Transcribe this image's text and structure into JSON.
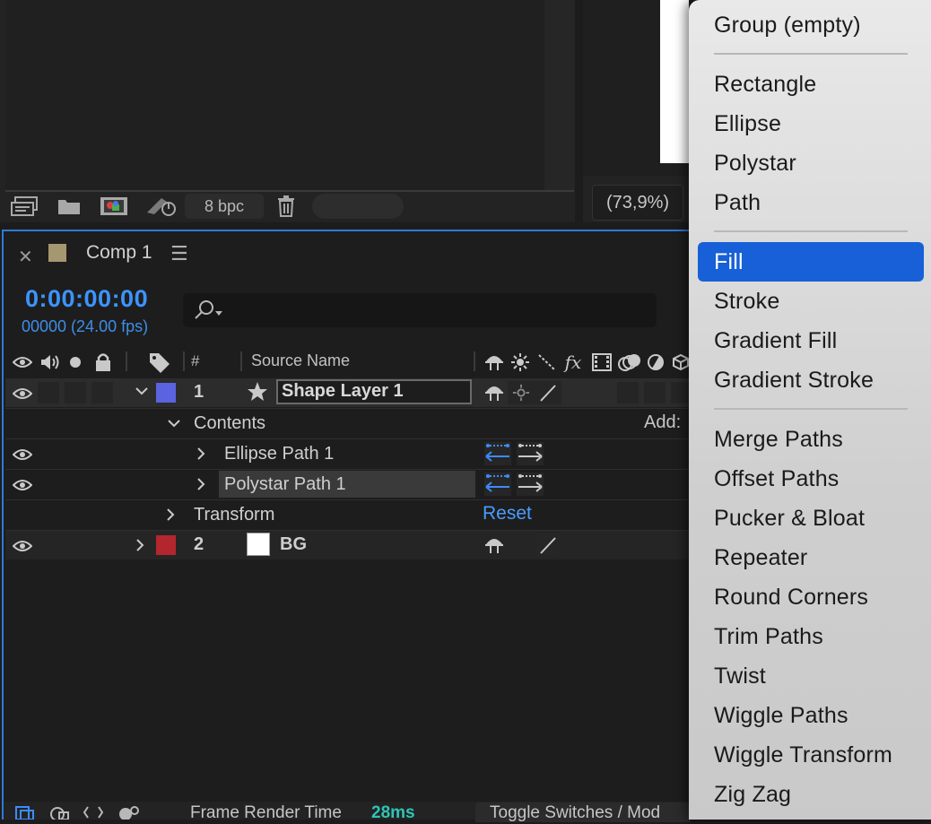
{
  "project_panel": {
    "bit_depth": "8 bpc"
  },
  "viewer": {
    "zoom": "(73,9%)"
  },
  "timeline": {
    "comp_name": "Comp 1",
    "timecode": "0:00:00:00",
    "frames": "00000 (24.00 fps)",
    "columns": {
      "number": "#",
      "source_name": "Source Name"
    },
    "add_label": "Add:",
    "layers": [
      {
        "number": "1",
        "name": "Shape Layer 1",
        "label_color": "#5b63e0"
      },
      {
        "number": "2",
        "name": "BG",
        "label_color": "#b3262e"
      }
    ],
    "contents_label": "Contents",
    "paths": [
      "Ellipse Path 1",
      "Polystar Path 1"
    ],
    "transform_label": "Transform",
    "reset_label": "Reset",
    "footer": {
      "frame_render_label": "Frame Render Time",
      "frame_render_value": "28ms",
      "toggle_label": "Toggle Switches / Mod"
    }
  },
  "context_menu": {
    "items": [
      "Group (empty)",
      "Rectangle",
      "Ellipse",
      "Polystar",
      "Path",
      "Fill",
      "Stroke",
      "Gradient Fill",
      "Gradient Stroke",
      "Merge Paths",
      "Offset Paths",
      "Pucker & Bloat",
      "Repeater",
      "Round Corners",
      "Trim Paths",
      "Twist",
      "Wiggle Paths",
      "Wiggle Transform",
      "Zig Zag"
    ],
    "highlighted": "Fill",
    "highlight_color": "#1760d8"
  },
  "colors": {
    "accent_blue": "#3c94ff",
    "render_time": "#2ec4b6",
    "comp_swatch": "#a59870"
  }
}
